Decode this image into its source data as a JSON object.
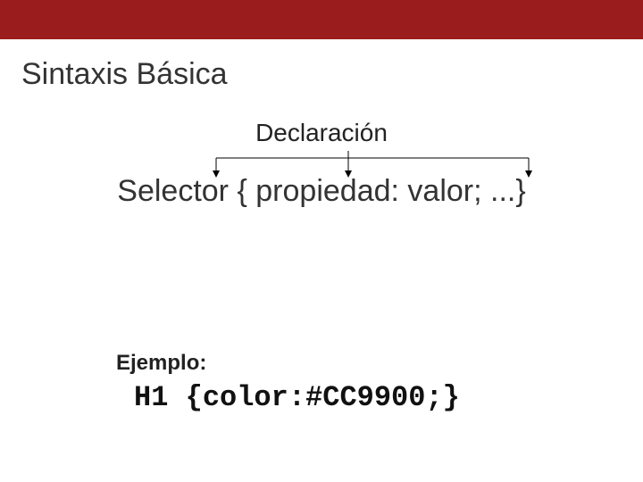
{
  "header": {
    "title": "Sintaxis Básica"
  },
  "diagram": {
    "declaration_label": "Declaración",
    "syntax_parts": {
      "selector": "Selector ",
      "open_brace": "{ ",
      "property": "propiedad",
      "colon": ": ",
      "value": "valor",
      "semicolon": "; ",
      "ellipsis": "...",
      "close_brace": "}"
    }
  },
  "example": {
    "label": "Ejemplo:",
    "code": "H1 {color:#CC9900;}"
  }
}
